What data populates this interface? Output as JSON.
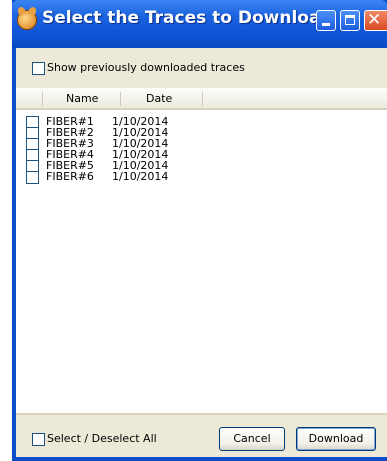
{
  "window": {
    "title": "Select the Traces to Download"
  },
  "options": {
    "show_previous_label": "Show previously downloaded traces"
  },
  "list": {
    "columns": [
      "Name",
      "Date"
    ],
    "rows": [
      {
        "name": "FIBER#1",
        "date": "1/10/2014"
      },
      {
        "name": "FIBER#2",
        "date": "1/10/2014"
      },
      {
        "name": "FIBER#3",
        "date": "1/10/2014"
      },
      {
        "name": "FIBER#4",
        "date": "1/10/2014"
      },
      {
        "name": "FIBER#5",
        "date": "1/10/2014"
      },
      {
        "name": "FIBER#6",
        "date": "1/10/2014"
      }
    ]
  },
  "footer": {
    "select_all_label": "Select / Deselect All",
    "cancel_label": "Cancel",
    "download_label": "Download"
  },
  "colors": {
    "titlebar": "#0d55d6",
    "client": "#ece9d8",
    "close": "#d84a20"
  }
}
